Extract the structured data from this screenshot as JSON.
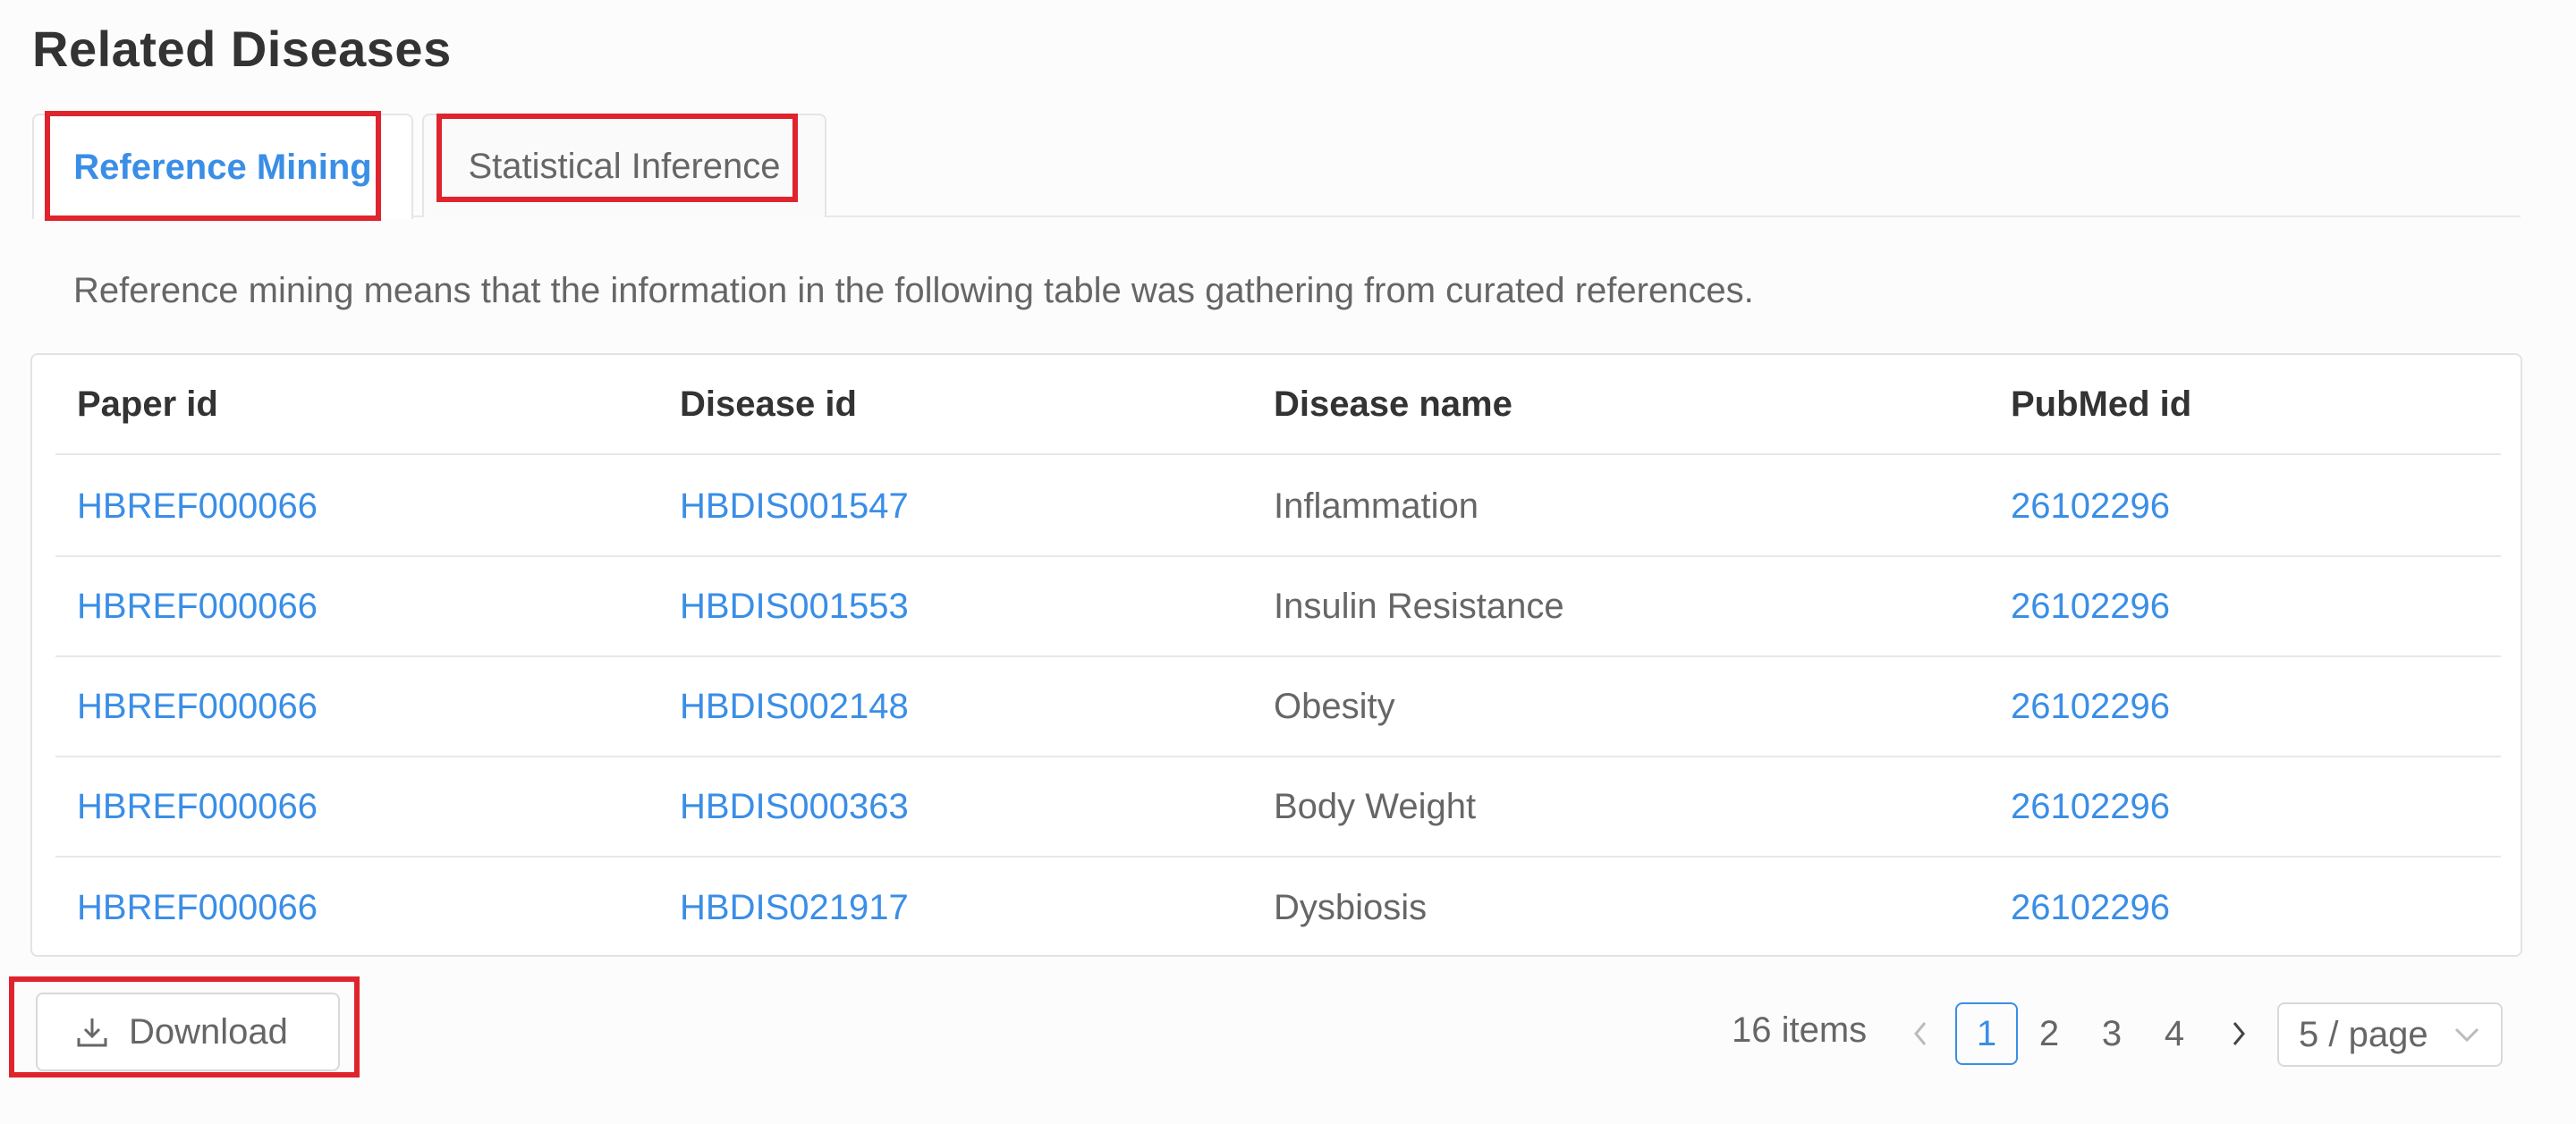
{
  "section_title": "Related Diseases",
  "tabs": [
    {
      "label": "Reference Mining",
      "active": true
    },
    {
      "label": "Statistical Inference",
      "active": false
    }
  ],
  "description": "Reference mining means that the information in the following table was gathering from curated references.",
  "table": {
    "columns": [
      "Paper id",
      "Disease id",
      "Disease name",
      "PubMed id"
    ],
    "rows": [
      [
        "HBREF000066",
        "HBDIS001547",
        "Inflammation",
        "26102296"
      ],
      [
        "HBREF000066",
        "HBDIS001553",
        "Insulin Resistance",
        "26102296"
      ],
      [
        "HBREF000066",
        "HBDIS002148",
        "Obesity",
        "26102296"
      ],
      [
        "HBREF000066",
        "HBDIS000363",
        "Body Weight",
        "26102296"
      ],
      [
        "HBREF000066",
        "HBDIS021917",
        "Dysbiosis",
        "26102296"
      ]
    ]
  },
  "download_label": "Download",
  "pagination": {
    "total": "16 items",
    "pages": [
      "1",
      "2",
      "3",
      "4"
    ],
    "current": "1",
    "prev_icon": "chevron-left-icon",
    "next_icon": "chevron-right-icon",
    "page_size": "5 / page"
  },
  "colors": {
    "accent": "#3a8ee6",
    "highlight": "#e0242d"
  }
}
